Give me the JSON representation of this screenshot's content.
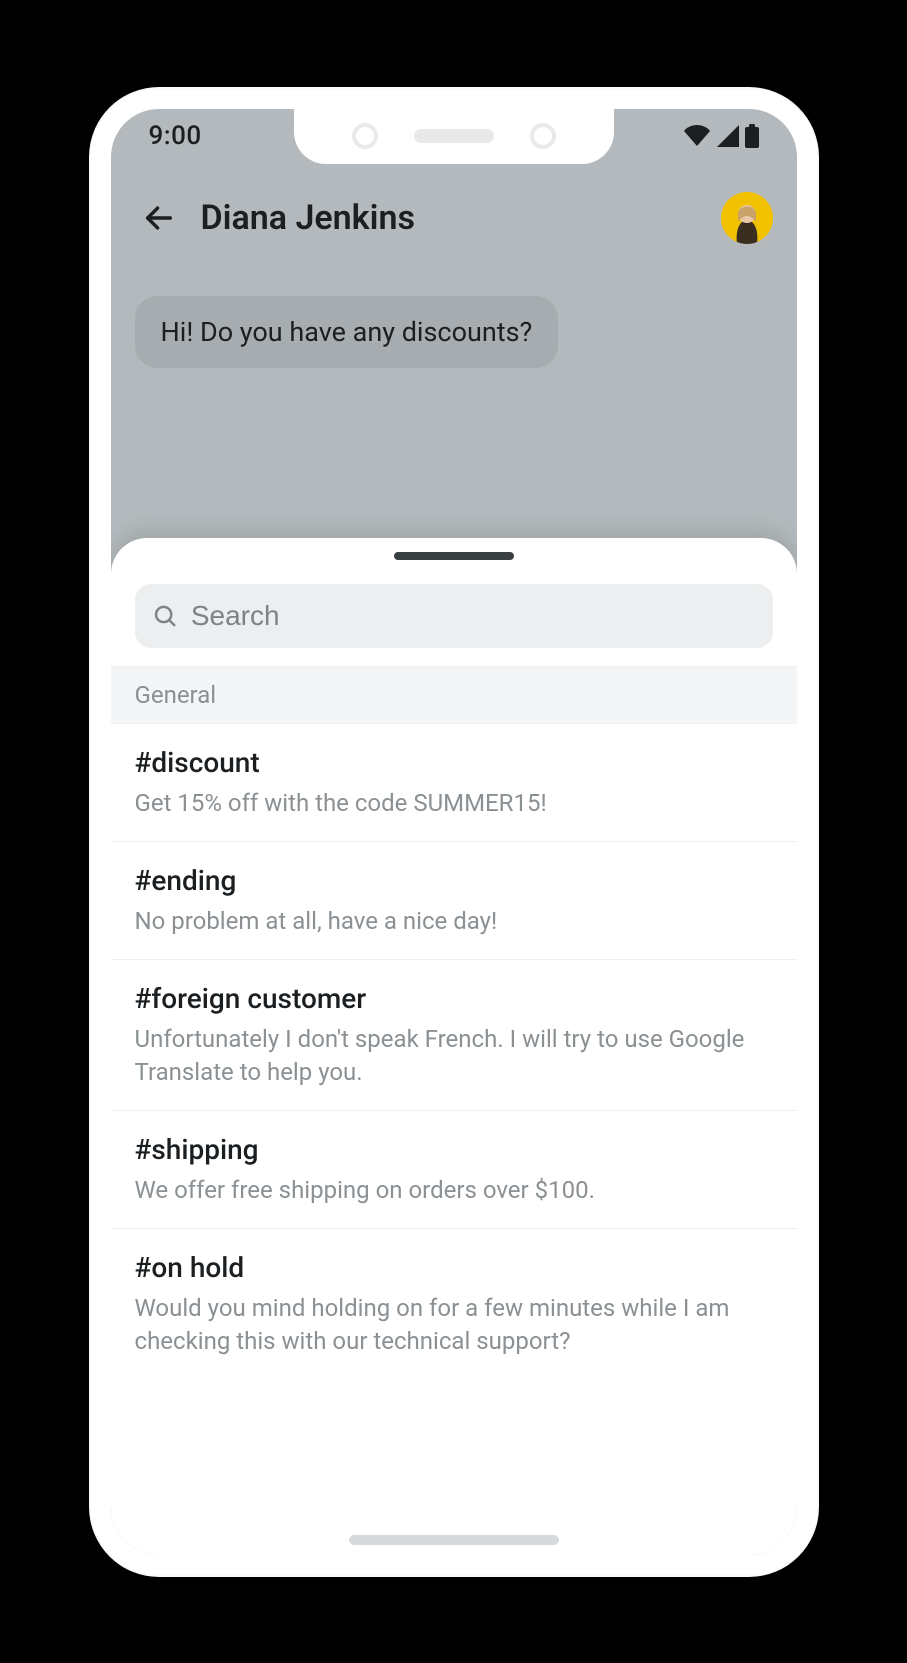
{
  "statusbar": {
    "time": "9:00"
  },
  "header": {
    "title": "Diana Jenkins"
  },
  "chat": {
    "incoming_message": "Hi! Do you have any discounts?"
  },
  "sheet": {
    "search_placeholder": "Search",
    "section_label": "General",
    "items": [
      {
        "tag": "#discount",
        "desc": "Get 15% off with the code SUMMER15!"
      },
      {
        "tag": "#ending",
        "desc": "No problem at all, have a nice day!"
      },
      {
        "tag": "#foreign customer",
        "desc": "Unfortunately I don't speak French. I will try to use Google Translate to help you."
      },
      {
        "tag": "#shipping",
        "desc": "We offer free shipping on orders over $100."
      },
      {
        "tag": "#on hold",
        "desc": "Would you mind holding on for a few minutes while I am checking this with our technical support?"
      }
    ]
  }
}
